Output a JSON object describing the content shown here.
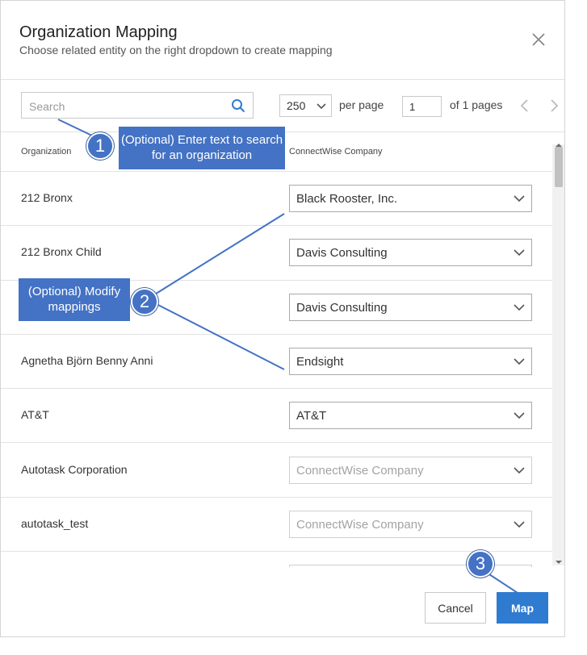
{
  "dialog": {
    "title": "Organization Mapping",
    "subtitle": "Choose related entity on the right dropdown to create mapping"
  },
  "toolbar": {
    "search_placeholder": "Search",
    "per_page_value": "250",
    "per_page_label": "per page",
    "page_number": "1",
    "of_pages": "of 1 pages"
  },
  "table": {
    "columns": [
      "Organization",
      "ConnectWise Company"
    ],
    "rows": [
      {
        "organization": "212 Bronx",
        "company": "Black Rooster, Inc."
      },
      {
        "organization": "212 Bronx Child",
        "company": "Davis Consulting"
      },
      {
        "organization": "",
        "company": "Davis Consulting"
      },
      {
        "organization": "Agnetha Björn Benny Anni",
        "company": "Endsight"
      },
      {
        "organization": "AT&T",
        "company": "AT&T"
      },
      {
        "organization": "Autotask Corporation",
        "company": "ConnectWise Company"
      },
      {
        "organization": "autotask_test",
        "company": "ConnectWise Company"
      }
    ]
  },
  "footer": {
    "cancel_label": "Cancel",
    "map_label": "Map"
  },
  "annotations": {
    "callout1": "(Optional) Enter text to search for an organization",
    "callout2": "(Optional) Modify mappings",
    "badge1": "1",
    "badge2": "2",
    "badge3": "3"
  },
  "colors": {
    "primary_button": "#2f7bd0",
    "annotation": "#4472c4"
  }
}
